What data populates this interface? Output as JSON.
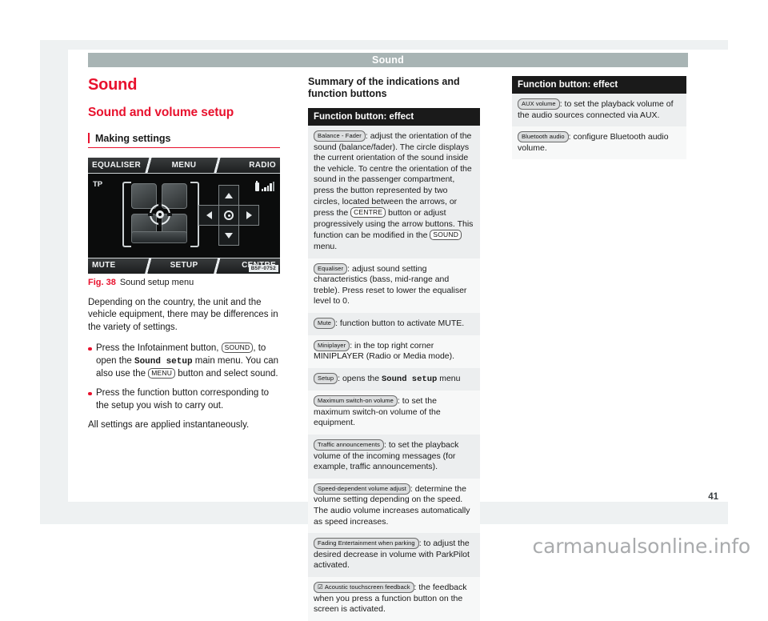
{
  "running_header": {
    "title": "Sound"
  },
  "page_number": "41",
  "watermark": "carmanualsonline.info",
  "left": {
    "chapter_title": "Sound",
    "section_title": "Sound and volume setup",
    "subsection_title": "Making settings",
    "figure": {
      "screen": {
        "top_left_key": "EQUALISER",
        "top_center_key": "MENU",
        "top_right_key": "RADIO",
        "bottom_left_key": "MUTE",
        "bottom_center_key": "SETUP",
        "bottom_right_key": "CENTRE",
        "tp_label": "TP",
        "image_id": "B5F-0752"
      },
      "caption_label": "Fig. 38",
      "caption_text": "Sound setup menu"
    },
    "paragraph_1": "Depending on the country, the unit and the vehicle equipment, there may be differences in the variety of settings.",
    "bullet_1": {
      "part_1": "Press the Infotainment button, ",
      "key_1": "SOUND",
      "part_2": ", to open the ",
      "mono_1": "Sound setup",
      "part_3": " main menu. You can also use the ",
      "key_2": "MENU",
      "part_4": " button and select sound."
    },
    "bullet_2": "Press the function button corresponding to the setup you wish to carry out.",
    "paragraph_2": "All settings are applied instantaneously."
  },
  "middle": {
    "heading": "Summary of the indications and function buttons",
    "table_header": "Function button: effect",
    "rows": [
      {
        "button": "Balance - Fader",
        "text_1": ": adjust the orientation of the sound (balance/fader). The circle displays the current orientation of the sound inside the vehicle. To centre the orientation of the sound in the passenger compartment, press the button represented by two circles, located between the arrows, or press the ",
        "inline_key_1": "CENTRE",
        "text_2": " button or adjust progressively using the arrow buttons. This function can be modified in the ",
        "inline_key_2": "SOUND",
        "text_3": " menu."
      },
      {
        "button": "Equaliser",
        "text_1": ": adjust sound setting characteristics (bass, mid-range and treble). Press reset to lower the equaliser level to 0."
      },
      {
        "button": "Mute",
        "text_1": ": function button to activate MUTE."
      },
      {
        "button": "Miniplayer",
        "text_1": ": in the top right corner MINIPLAYER (Radio or Media mode)."
      },
      {
        "button": "Setup",
        "text_1": ": opens the ",
        "mono_1": "Sound setup",
        "text_2": " menu"
      },
      {
        "button": "Maximum switch-on volume",
        "text_1": ": to set the maximum switch-on volume of the equipment."
      },
      {
        "button": "Traffic announcements",
        "text_1": ": to set the playback volume of the incoming messages (for example, traffic announcements)."
      },
      {
        "button": "Speed-dependent volume adjust",
        "text_1": ": determine the volume setting depending on the speed. The audio volume increases automatically as speed increases."
      },
      {
        "button": "Fading Entertainment when parking",
        "text_1": ": to adjust the desired decrease in volume with ParkPilot activated."
      },
      {
        "button": "Acoustic touchscreen feedback",
        "checkbox": "☑",
        "text_1": ": the feedback when you press a function button on the screen is activated."
      }
    ]
  },
  "right": {
    "table_header": "Function button: effect",
    "rows": [
      {
        "button": "AUX volume",
        "text_1": ": to set the playback volume of the audio sources connected via AUX."
      },
      {
        "button": "Bluetooth audio",
        "text_1": ": configure Bluetooth audio volume."
      }
    ]
  },
  "colors": {
    "brand_red": "#e8112d",
    "header_gray": "#a8b4b4",
    "panel_gray": "#eef1f2",
    "table_header_black": "#1a1a1a"
  }
}
